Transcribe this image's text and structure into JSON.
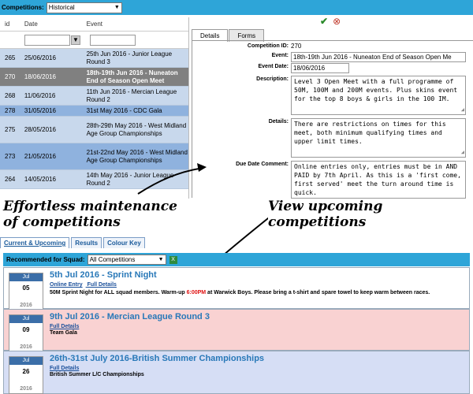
{
  "topbar": {
    "label": "Competitions:",
    "selected": "Historical"
  },
  "grid": {
    "headers": [
      "id",
      "Date",
      "Event"
    ],
    "rows": [
      {
        "id": "265",
        "date": "25/06/2016",
        "event": "25th Jun 2016 - Junior League Round 3"
      },
      {
        "id": "270",
        "date": "18/06/2016",
        "event": "18th-19th Jun 2016 - Nuneaton End of Season Open Meet"
      },
      {
        "id": "268",
        "date": "11/06/2016",
        "event": "11th Jun 2016 - Mercian League Round 2"
      },
      {
        "id": "278",
        "date": "31/05/2016",
        "event": "31st May 2016 - CDC Gala"
      },
      {
        "id": "275",
        "date": "28/05/2016",
        "event": "28th-29th May 2016 - West Midland Age Group Championships"
      },
      {
        "id": "273",
        "date": "21/05/2016",
        "event": "21st-22nd May 2016 - West Midland Age Group Championships"
      },
      {
        "id": "264",
        "date": "14/05/2016",
        "event": "14th May 2016 - Junior League Round 2"
      }
    ]
  },
  "form": {
    "tabs": [
      "Details",
      "Forms"
    ],
    "competition_id_label": "Competition ID:",
    "competition_id": "270",
    "event_label": "Event:",
    "event": "18th-19th Jun 2016 - Nuneaton End of Season Open Me",
    "event_date_label": "Event Date:",
    "event_date": "18/06/2016",
    "description_label": "Description:",
    "description": "Level 3 Open Meet with a full programme of 50M, 100M and 200M events. Plus skins event for the top 8 boys & girls in the 100 IM.",
    "details_label": "Details:",
    "details": "There are restrictions on times for this meet, both minimum qualifying times and upper limit times.",
    "due_label": "Due Date Comment:",
    "due": "Online entries only, entries must be in AND PAID by 7th April. As this is a 'first come, first served' meet the turn around time is quick."
  },
  "captions": {
    "maintenance": "Effortless maintenance of competitions",
    "upcoming": "View upcoming competitions"
  },
  "bottom": {
    "tabs": [
      "Current & Upcoming",
      "Results",
      "Colour Key"
    ],
    "squad_label": "Recommended for Squad:",
    "squad_selected": "All Competitions",
    "events": [
      {
        "month": "Jul",
        "day": "05",
        "year": "2016",
        "title": "5th Jul 2016 - Sprint Night",
        "links": [
          "Online Entry",
          "Full Details"
        ],
        "desc_a": "50M Sprint Night for ALL squad members. Warm-up ",
        "desc_red": "6:00PM",
        "desc_b": " at Warwick Boys. Please bring a t-shirt and spare towel to keep warm between races.",
        "bg": "#ffffff"
      },
      {
        "month": "Jul",
        "day": "09",
        "year": "2016",
        "title": "9th Jul 2016 - Mercian League Round 3",
        "links": [
          "Full Details"
        ],
        "desc_a": "Team Gala",
        "desc_red": "",
        "desc_b": "",
        "bg": "#f9d2d2"
      },
      {
        "month": "Jul",
        "day": "26",
        "year": "2016",
        "title": "26th-31st July 2016-British Summer Championships",
        "links": [
          "Full Details"
        ],
        "desc_a": "British Summer L/C Championships",
        "desc_red": "",
        "desc_b": "",
        "bg": "#d6def5"
      }
    ]
  }
}
